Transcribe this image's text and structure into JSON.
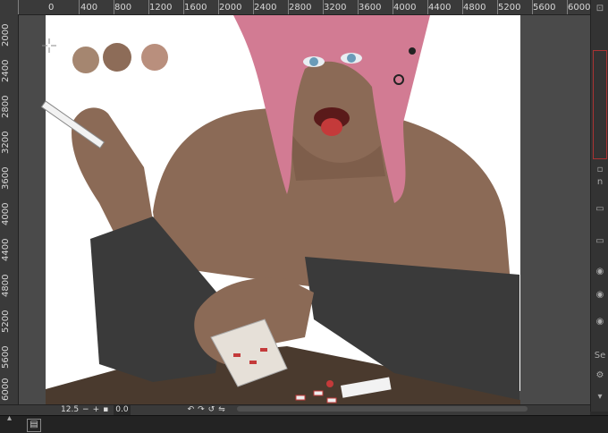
{
  "ruler_top": {
    "labels": [
      "0",
      "400",
      "800",
      "1200",
      "1600",
      "2000",
      "2400",
      "2800",
      "3200",
      "3600",
      "4000",
      "4400",
      "4800",
      "5200",
      "5600",
      "6000"
    ]
  },
  "ruler_left": {
    "labels": [
      "2000",
      "2400",
      "2800",
      "3200",
      "3600",
      "4000",
      "4400",
      "4800",
      "5200",
      "5600",
      "6000"
    ]
  },
  "status_bar": {
    "zoom": "12.5",
    "angle": "0.0"
  },
  "colors": {
    "swatch_1": "#a58670",
    "swatch_2": "#8d6c58",
    "swatch_3": "#b98f7d",
    "skin": "#8b6a56",
    "hair": "#d27b93",
    "sleeve": "#3a3a3a",
    "table": "#4a3a2e",
    "accent_red": "#c43a3a"
  },
  "right_panel": {
    "items": [
      "n",
      "Se"
    ]
  }
}
